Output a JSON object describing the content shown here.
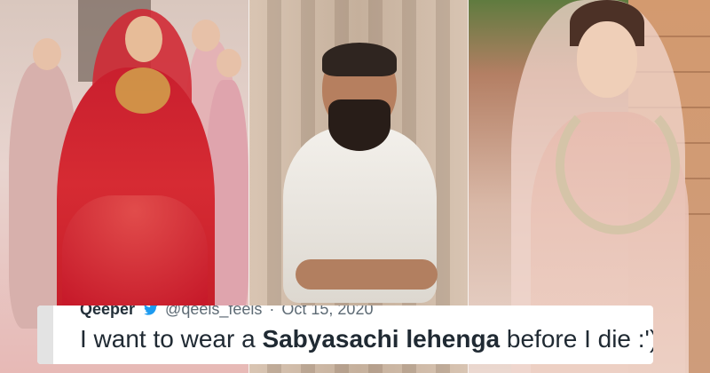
{
  "image": {
    "panels": {
      "left": {},
      "middle": {},
      "right": {}
    }
  },
  "tweet": {
    "name": "Qeeper",
    "handle": "@qeels_feels",
    "separator": "·",
    "date": "Oct 15, 2020",
    "text_before": "I want to wear a ",
    "text_bold": "Sabyasachi lehenga",
    "text_after": " before I die :')",
    "icon": "twitter-bird-icon"
  },
  "colors": {
    "tweet_background": "#ffffff",
    "tweet_text": "#202a33",
    "tweet_meta": "#5d6a74",
    "accent_red": "#c91f2e",
    "accent_pink": "#e7bcaf"
  }
}
